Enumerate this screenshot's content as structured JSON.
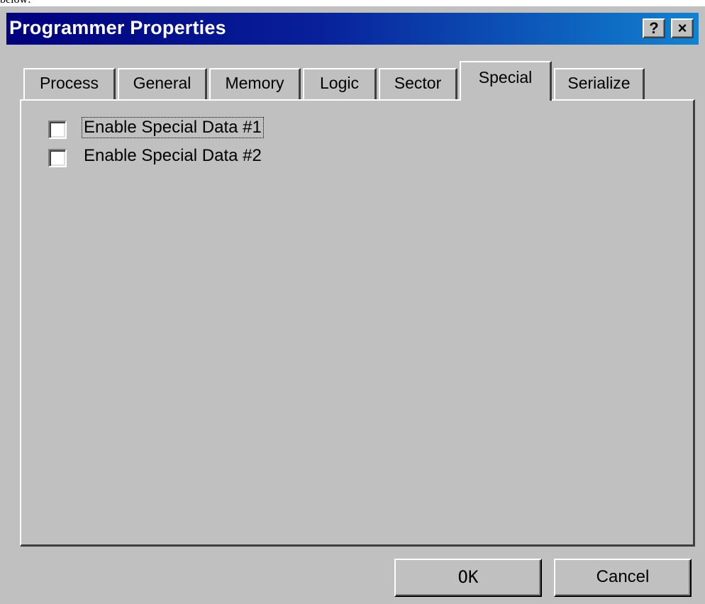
{
  "above_window_text": "below:",
  "window": {
    "title": "Programmer Properties",
    "help_label": "?",
    "close_label": "×"
  },
  "tabs": [
    {
      "label": "Process"
    },
    {
      "label": "General"
    },
    {
      "label": "Memory"
    },
    {
      "label": "Logic"
    },
    {
      "label": "Sector"
    },
    {
      "label": "Special",
      "active": true
    },
    {
      "label": "Serialize"
    }
  ],
  "special": {
    "options": [
      {
        "label": "Enable Special Data #1",
        "checked": false,
        "focused": true
      },
      {
        "label": "Enable Special Data #2",
        "checked": false
      }
    ]
  },
  "buttons": {
    "ok_label": "OK",
    "cancel_label": "Cancel"
  },
  "colors": {
    "titlebar_start": "#00007d",
    "titlebar_end": "#1083d0",
    "face": "#c0c0c0"
  }
}
